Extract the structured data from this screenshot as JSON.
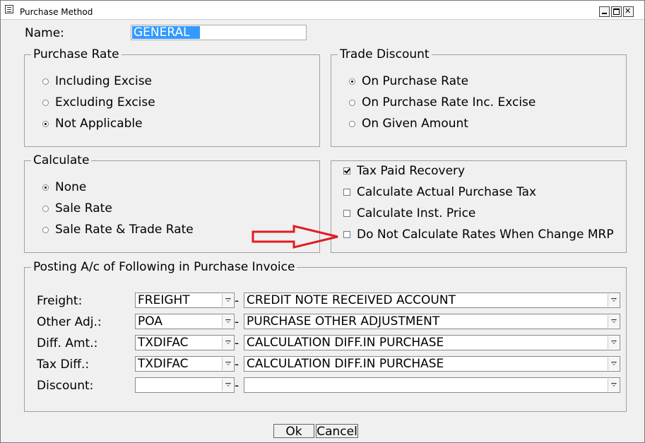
{
  "window": {
    "title": "Purchase Method"
  },
  "name": {
    "label": "Name:",
    "value": "GENERAL"
  },
  "purchase_rate": {
    "title": "Purchase Rate",
    "options": [
      {
        "label": "Including Excise",
        "selected": false
      },
      {
        "label": "Excluding Excise",
        "selected": false
      },
      {
        "label": "Not Applicable",
        "selected": true
      }
    ]
  },
  "trade_discount": {
    "title": "Trade Discount",
    "options": [
      {
        "label": "On Purchase Rate",
        "selected": true
      },
      {
        "label": "On Purchase Rate Inc. Excise",
        "selected": false
      },
      {
        "label": "On Given Amount",
        "selected": false
      }
    ]
  },
  "calculate": {
    "title": "Calculate",
    "options": [
      {
        "label": "None",
        "selected": true
      },
      {
        "label": "Sale Rate",
        "selected": false
      },
      {
        "label": "Sale Rate & Trade Rate",
        "selected": false
      }
    ]
  },
  "checkboxes": [
    {
      "label": "Tax Paid Recovery",
      "checked": true
    },
    {
      "label": "Calculate Actual Purchase Tax",
      "checked": false
    },
    {
      "label": "Calculate Inst. Price",
      "checked": false
    },
    {
      "label": "Do Not Calculate Rates When Change MRP",
      "checked": false
    }
  ],
  "posting": {
    "title": "Posting A/c of Following in Purchase Invoice",
    "separator": "-",
    "rows": [
      {
        "label": "Freight:",
        "code": "FREIGHT",
        "account": "CREDIT NOTE RECEIVED ACCOUNT"
      },
      {
        "label": "Other Adj.:",
        "code": "POA",
        "account": "PURCHASE OTHER ADJUSTMENT"
      },
      {
        "label": "Diff. Amt.:",
        "code": "TXDIFAC",
        "account": "CALCULATION DIFF.IN PURCHASE"
      },
      {
        "label": "Tax Diff.:",
        "code": "TXDIFAC",
        "account": "CALCULATION DIFF.IN PURCHASE"
      },
      {
        "label": "Discount:",
        "code": "",
        "account": ""
      }
    ]
  },
  "buttons": {
    "ok": "Ok",
    "cancel": "Cancel"
  },
  "colors": {
    "annotation_arrow": "#e31b23",
    "selection": "#3399ff"
  }
}
